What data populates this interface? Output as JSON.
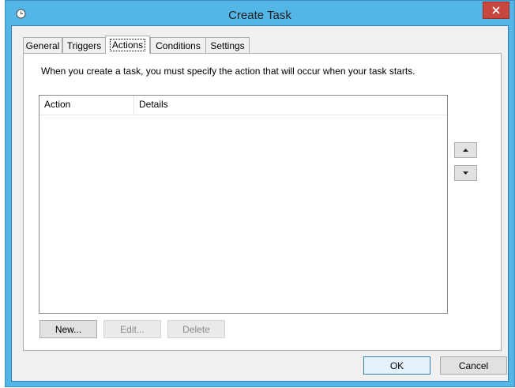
{
  "dialog": {
    "title": "Create Task",
    "description": "When you create a task, you must specify the action that will occur when your task starts."
  },
  "tabs": [
    {
      "label": "General"
    },
    {
      "label": "Triggers"
    },
    {
      "label": "Actions",
      "active": true
    },
    {
      "label": "Conditions"
    },
    {
      "label": "Settings"
    }
  ],
  "actions_list": {
    "columns": [
      "Action",
      "Details"
    ],
    "rows": []
  },
  "buttons": {
    "new": "New...",
    "edit": "Edit...",
    "delete": "Delete",
    "ok": "OK",
    "cancel": "Cancel"
  },
  "icons": {
    "title": "clock-icon",
    "close": "close-icon",
    "move_up": "arrow-up-icon",
    "move_down": "arrow-down-icon"
  },
  "colors": {
    "titlebar": "#54b6e6",
    "close_button": "#c7463e",
    "default_button_border": "#3c7fb1"
  }
}
